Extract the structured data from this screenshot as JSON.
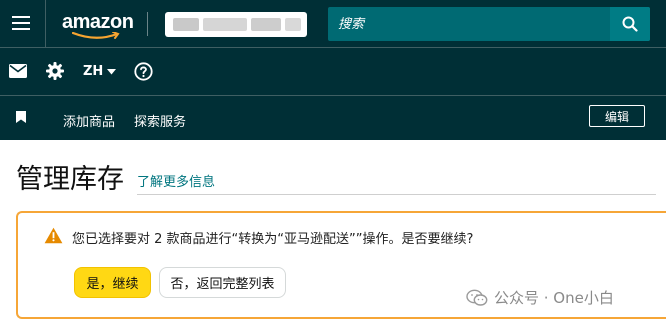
{
  "header": {
    "logo_text": "amazon",
    "search_placeholder": "搜索",
    "language": "ZH"
  },
  "nav": {
    "add_product": "添加商品",
    "explore_services": "探索服务",
    "edit_label": "编辑"
  },
  "page": {
    "title": "管理库存",
    "learn_more": "了解更多信息"
  },
  "alert": {
    "message": "您已选择要对 2 款商品进行“转换为“亚马逊配送””操作。是否要继续?",
    "confirm_label": "是，继续",
    "back_label": "否，返回完整列表"
  },
  "watermark": {
    "text": "公众号 · One小白"
  },
  "colors": {
    "header_bg": "#002f36",
    "search_bg": "#006a73",
    "confirm_bg": "#ffd814",
    "alert_border": "#f6a637",
    "link": "#00757f"
  }
}
